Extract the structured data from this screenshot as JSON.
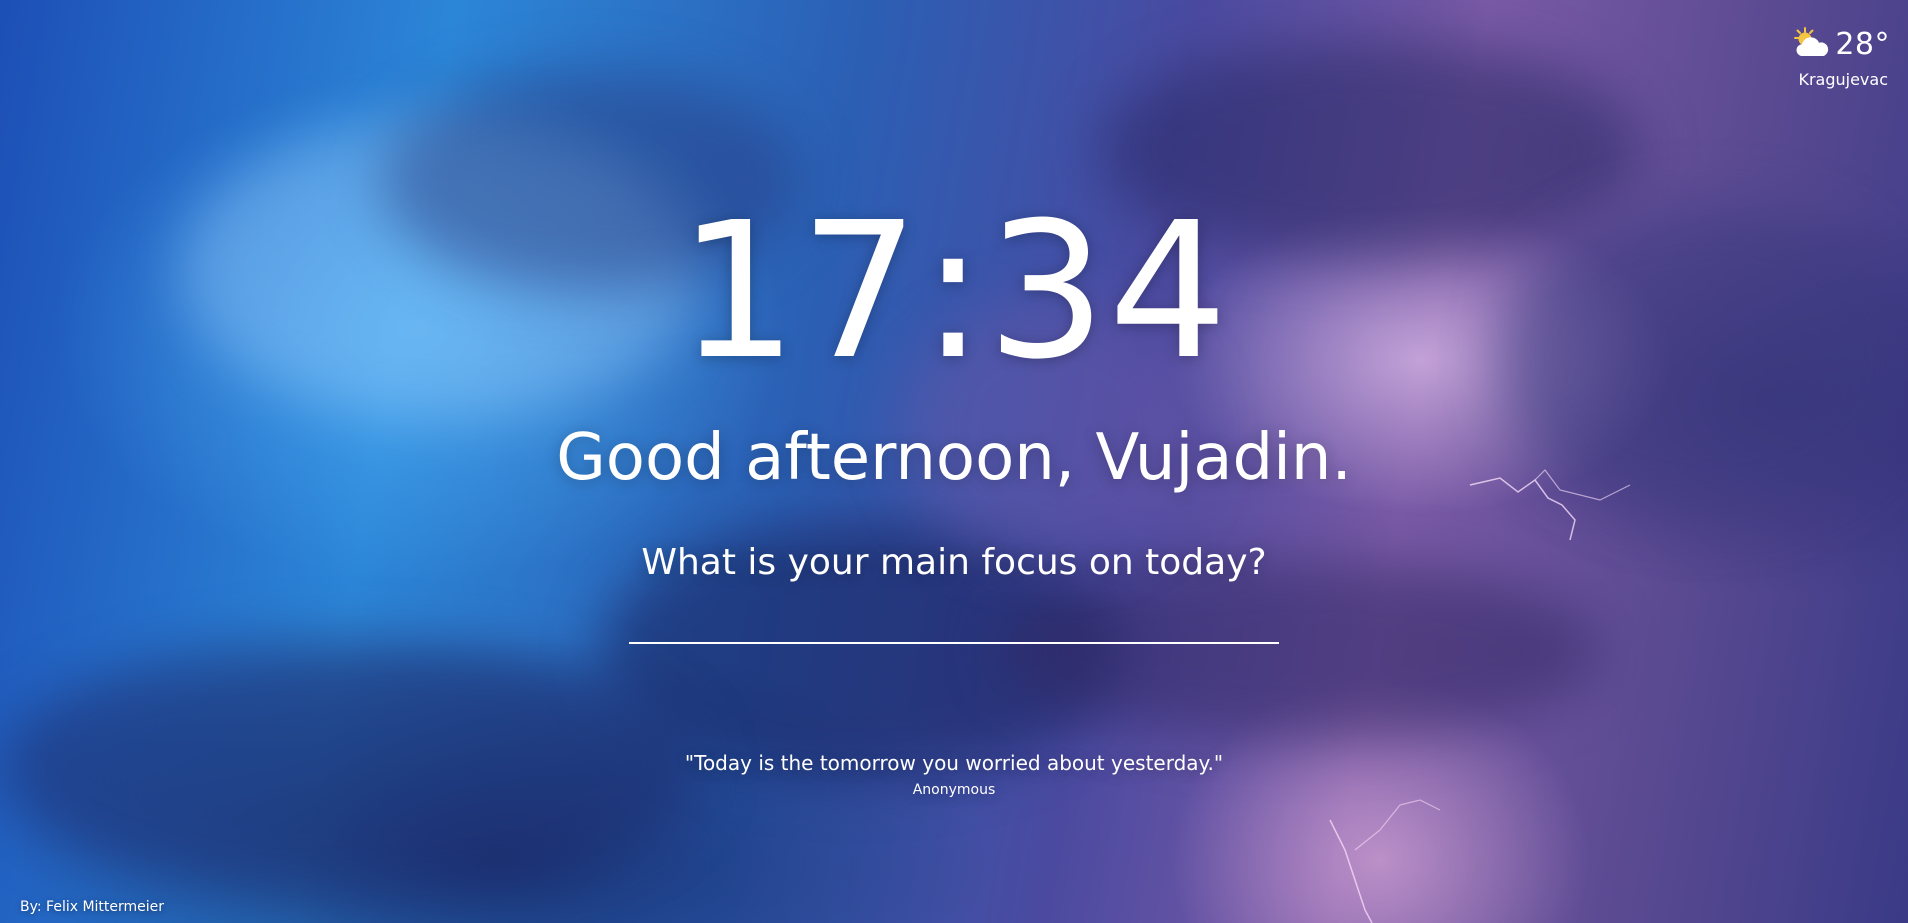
{
  "weather": {
    "icon": "partly-sunny-icon",
    "temperature": "28°",
    "location": "Kragujevac"
  },
  "clock": {
    "time": "17:34"
  },
  "greeting": "Good afternoon, Vujadin.",
  "focus": {
    "question": "What is your main focus on today?",
    "value": "",
    "placeholder": ""
  },
  "quote": {
    "text": "\"Today is the tomorrow you worried about yesterday.\"",
    "author": "Anonymous"
  },
  "background_credit": "By: Felix Mittermeier",
  "colors": {
    "text": "#ffffff",
    "sun": "#f5c542",
    "cloud": "#ffffff"
  }
}
